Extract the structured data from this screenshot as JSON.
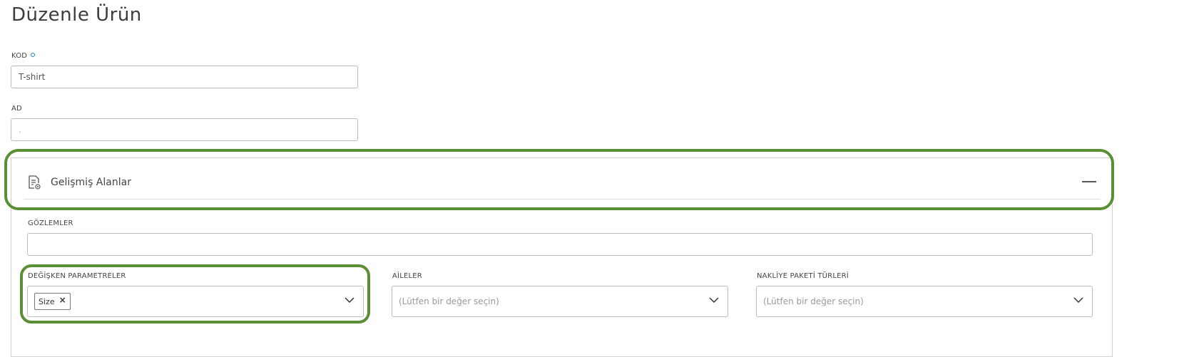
{
  "page": {
    "title": "Düzenle Ürün"
  },
  "fields": {
    "kod": {
      "label": "KOD",
      "value": "T-shirt"
    },
    "ad": {
      "label": "AD",
      "value": "."
    }
  },
  "advanced": {
    "title": "Gelişmiş Alanlar",
    "gozlemler": {
      "label": "GÖZLEMLER",
      "value": ""
    },
    "degisken": {
      "label": "DEĞİŞKEN PARAMETRELER",
      "tags": [
        "Size"
      ]
    },
    "aileler": {
      "label": "AİLELER",
      "placeholder": "(Lütfen bir değer seçin)"
    },
    "nakliye": {
      "label": "NAKLİYE PAKETİ TÜRLERİ",
      "placeholder": "(Lütfen bir değer seçin)"
    }
  },
  "colors": {
    "highlight": "#5a8f35",
    "required_dot": "#1a8fc9"
  },
  "icons": {
    "advanced_fields": "settings-list-icon",
    "collapse": "minus-icon",
    "dropdown": "chevron-down-icon",
    "remove": "close-icon"
  }
}
